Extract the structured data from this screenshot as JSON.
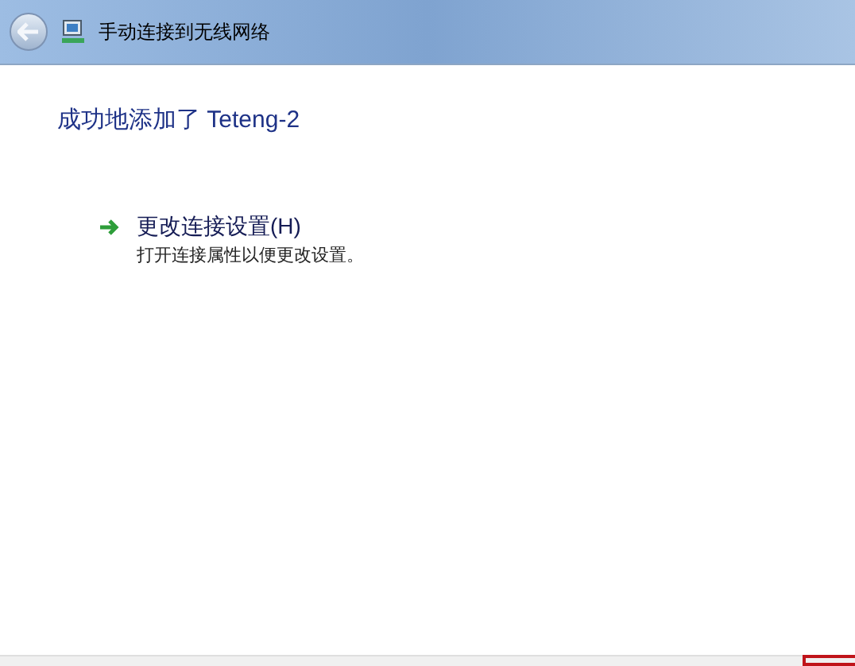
{
  "window": {
    "title": "手动连接到无线网络"
  },
  "heading": "成功地添加了 Teteng-2",
  "command_link": {
    "label": "更改连接设置(H)",
    "description": "打开连接属性以便更改设置。"
  }
}
